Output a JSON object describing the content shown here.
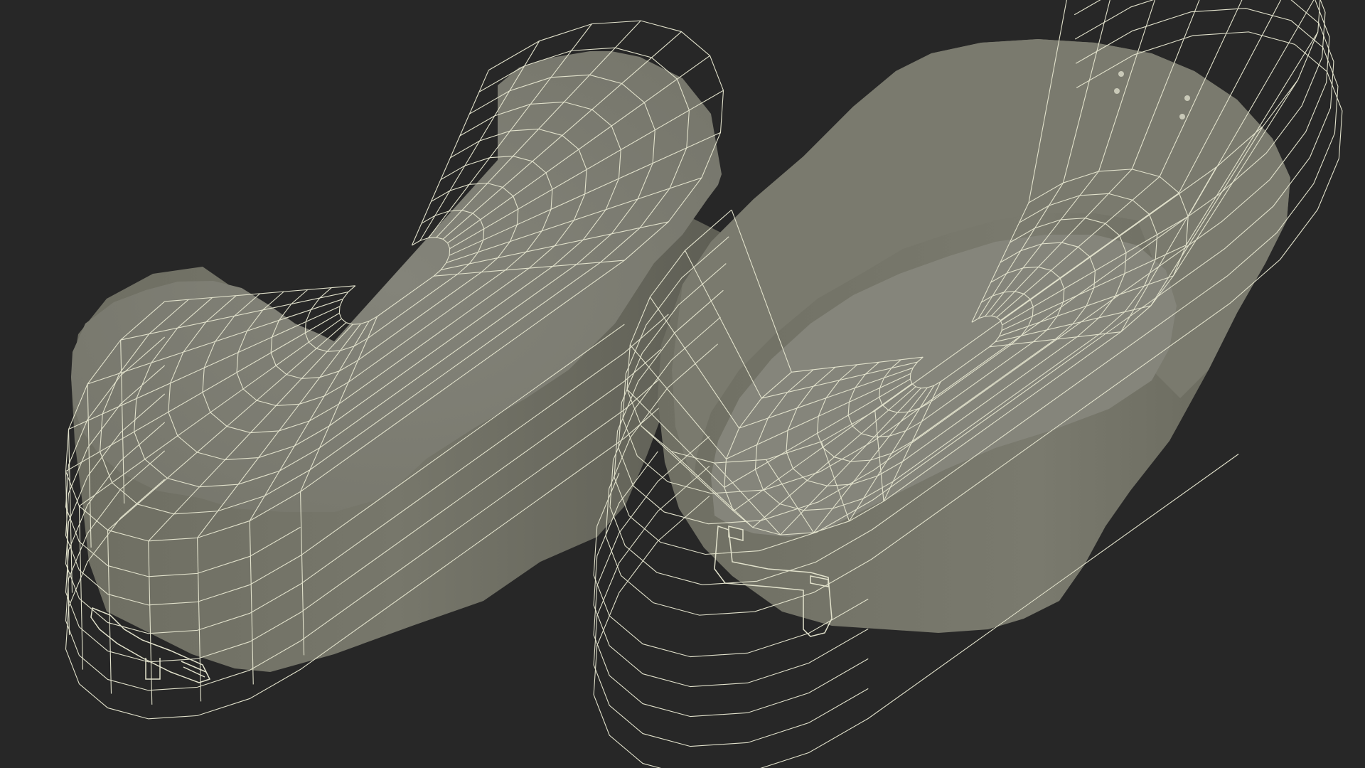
{
  "scene": {
    "background": "#272727",
    "objects": [
      {
        "name": "tub-upside-down",
        "view": "bottom",
        "handles": 2,
        "surface_color": "#7b7b6f",
        "wire_color": "#e2e2cc"
      },
      {
        "name": "tub-open",
        "view": "top-interior",
        "handles": 2,
        "rivets": 4,
        "surface_color": "#7c7c70",
        "wire_color": "#e2e2cc"
      }
    ]
  }
}
